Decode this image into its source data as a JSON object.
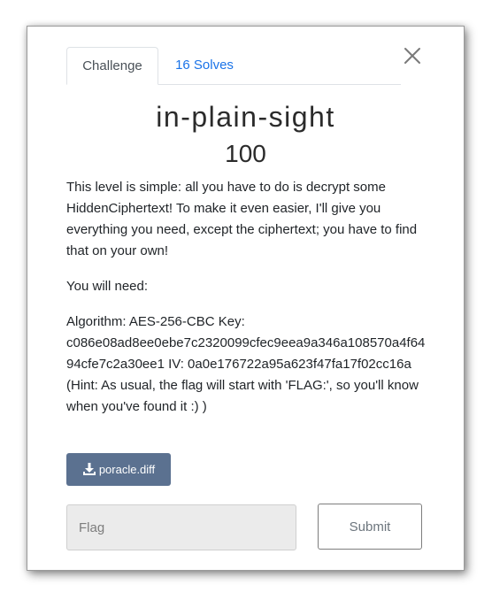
{
  "tabs": {
    "challenge_label": "Challenge",
    "solves_label": "16 Solves"
  },
  "challenge": {
    "name": "in-plain-sight",
    "points": "100",
    "description_p1": "This level is simple: all you have to do is decrypt some HiddenCiphertext! To make it even easier, I'll give you everything you need, except the ciphertext; you have to find that on your own!",
    "description_p2": "You will need:",
    "description_p3": "Algorithm: AES-256-CBC Key: c086e08ad8ee0ebe7c2320099cfec9eea9a346a108570a4f6494cfe7c2a30ee1 IV: 0a0e176722a95a623f47fa17f02cc16a (Hint: As usual, the flag will start with 'FLAG:', so you'll know when you've found it :) )"
  },
  "file": {
    "label": "poracle.diff",
    "icon": "download-icon"
  },
  "form": {
    "flag_placeholder": "Flag",
    "submit_label": "Submit"
  },
  "colors": {
    "tab_link": "#1a73e8",
    "download_button": "#5b7190",
    "input_bg": "#ebebeb"
  }
}
